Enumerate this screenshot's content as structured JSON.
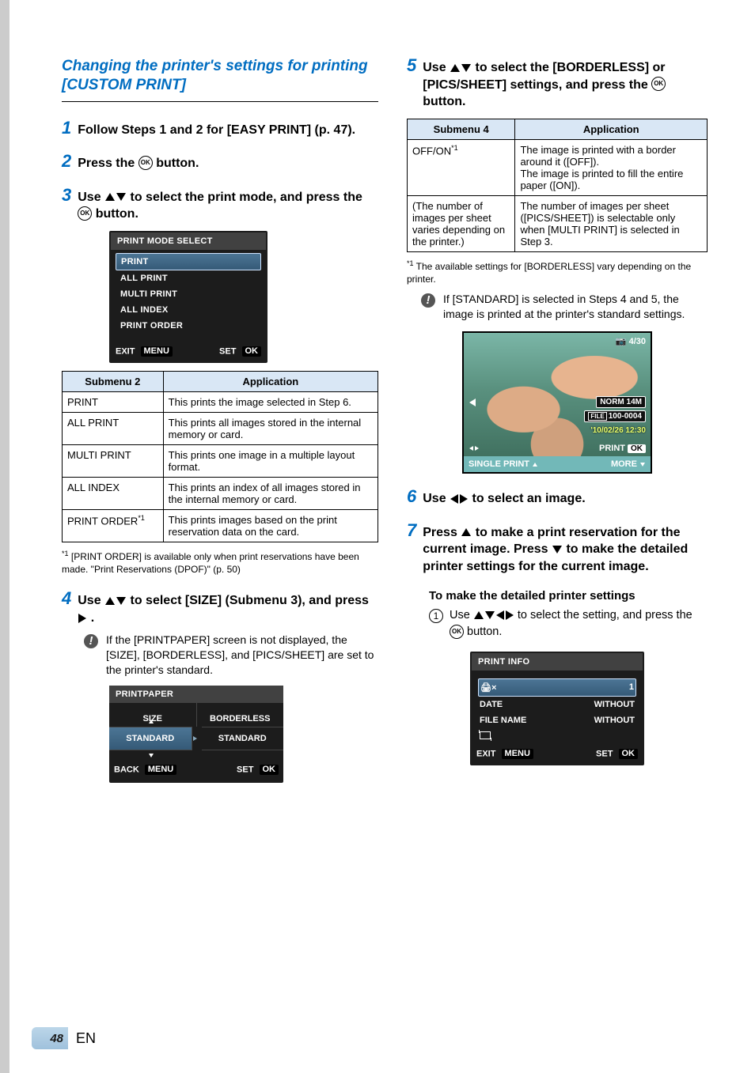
{
  "page": {
    "number": "48",
    "lang": "EN"
  },
  "section_title": "Changing the printer's settings for printing [CUSTOM PRINT]",
  "steps": {
    "s1": "Follow Steps 1 and 2 for [EASY PRINT] (p. 47).",
    "s2_a": "Press the ",
    "s2_b": " button.",
    "s3_a": "Use ",
    "s3_b": " to select the print mode, and press the ",
    "s3_c": " button.",
    "s4_a": "Use ",
    "s4_b": " to select [SIZE] (Submenu 3), and press ",
    "s4_c": ".",
    "s5_a": "Use ",
    "s5_b": " to select the [BORDERLESS] or [PICS/SHEET] settings, and press the ",
    "s5_c": " button.",
    "s6_a": "Use ",
    "s6_b": " to select an image.",
    "s7_a": "Press ",
    "s7_b": " to make a print reservation for the current image. Press ",
    "s7_c": " to make the detailed printer settings for the current image."
  },
  "note4": "If the [PRINTPAPER] screen is not displayed, the [SIZE], [BORDERLESS], and [PICS/SHEET] are set to the printer's standard.",
  "note5": "If [STANDARD] is selected in Steps 4 and 5, the image is printed at the printer's standard settings.",
  "footnote_left": "[PRINT ORDER] is available only when print reservations have been made. \"Print Reservations (DPOF)\" (p. 50)",
  "footnote_right": "The available settings for [BORDERLESS] vary depending on the printer.",
  "panel_mode": {
    "title": "PRINT MODE SELECT",
    "items": [
      "PRINT",
      "ALL PRINT",
      "MULTI PRINT",
      "ALL INDEX",
      "PRINT ORDER"
    ],
    "foot_left": "EXIT",
    "foot_right": "SET",
    "foot_left_chip": "MENU",
    "foot_right_chip": "OK"
  },
  "table2": {
    "h1": "Submenu 2",
    "h2": "Application",
    "rows": [
      {
        "k": "PRINT",
        "v": "This prints the image selected in Step 6."
      },
      {
        "k": "ALL PRINT",
        "v": "This prints all images stored in the internal memory or card."
      },
      {
        "k": "MULTI PRINT",
        "v": "This prints one image in a multiple layout format."
      },
      {
        "k": "ALL INDEX",
        "v": "This prints an index of all images stored in the internal memory or card."
      },
      {
        "k": "PRINT ORDER*1",
        "v": "This prints images based on the print reservation data on the card."
      }
    ]
  },
  "panel_paper": {
    "title": "PRINTPAPER",
    "h_left": "SIZE",
    "h_right": "BORDERLESS",
    "v_left": "STANDARD",
    "v_right": "STANDARD",
    "foot_left": "BACK",
    "foot_right": "SET",
    "foot_left_chip": "MENU",
    "foot_right_chip": "OK"
  },
  "table4": {
    "h1": "Submenu 4",
    "h2": "Application",
    "rows": [
      {
        "k": "OFF/ON*1",
        "v": "The image is printed with a border around it ([OFF]).\nThe image is printed to fill the entire paper ([ON])."
      },
      {
        "k": "(The number of images per sheet varies depending on the printer.)",
        "v": "The number of images per sheet ([PICS/SHEET]) is selectable only when [MULTI PRINT] is selected in Step 3."
      }
    ]
  },
  "photo": {
    "counter": "4/30",
    "norm": "NORM 14M",
    "file_prefix": "FILE",
    "file": "100-0004",
    "date": "'10/02/26 12:30",
    "print": "PRINT",
    "single": "SINGLE PRINT",
    "more": "MORE",
    "ok_chip": "OK"
  },
  "sub_h": "To make the detailed printer settings",
  "circ1_a": "Use ",
  "circ1_b": " to select the setting, and press the ",
  "circ1_c": " button.",
  "panel_info": {
    "title": "PRINT INFO",
    "rows": [
      {
        "k": "PRINTER-x",
        "v": "1",
        "iconic": true
      },
      {
        "k": "DATE",
        "v": "WITHOUT"
      },
      {
        "k": "FILE NAME",
        "v": "WITHOUT"
      },
      {
        "k": "TRIM",
        "v": "",
        "trim": true
      }
    ],
    "foot_left": "EXIT",
    "foot_right": "SET",
    "foot_left_chip": "MENU",
    "foot_right_chip": "OK"
  }
}
